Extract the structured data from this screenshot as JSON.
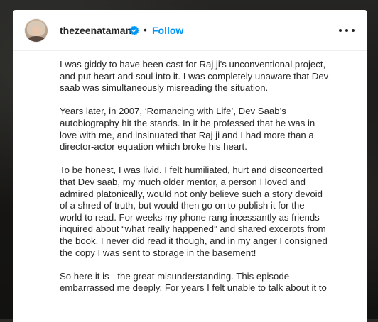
{
  "post": {
    "username": "thezeenataman",
    "separator": "•",
    "follow_label": "Follow",
    "verified_icon": "verified-badge-icon",
    "more_icon": "more-options-icon",
    "colors": {
      "follow": "#0095f6",
      "verified": "#0095f6",
      "text": "#262626"
    }
  },
  "caption": {
    "paragraphs": [
      {
        "lines": [
          "I was giddy to have been cast for Raj ji's unconventional project,",
          "and put heart and soul into it. I was completely unaware that Dev",
          "saab was simultaneously misreading the situation."
        ]
      },
      {
        "lines": [
          "Years later, in 2007, ‘Romancing with Life’, Dev Saab’s",
          "autobiography hit the stands. In it he professed that he was in",
          "love with me, and insinuated that Raj ji and I had more than a",
          "director-actor equation which broke his heart."
        ]
      },
      {
        "lines": [
          "To be honest, I was livid. I felt humiliated, hurt and disconcerted",
          "that Dev saab, my much older mentor, a person I loved and",
          "admired platonically, would not only believe such a story devoid",
          "of a shred of truth, but would then go on to publish it for the",
          "world to read. For weeks my phone rang incessantly as friends",
          "inquired about “what really happened” and shared excerpts from",
          "the book. I never did read it though, and in my anger I consigned",
          "the copy I was sent to storage in the basement!"
        ]
      },
      {
        "lines": [
          "So here it is - the great misunderstanding. This episode",
          "embarrassed me deeply. For years I felt unable to talk about it to"
        ]
      }
    ]
  }
}
